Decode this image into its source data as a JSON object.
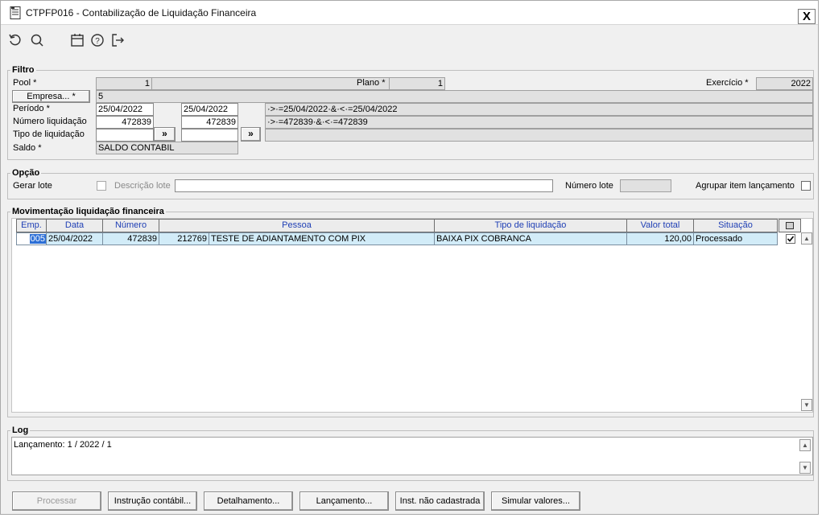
{
  "window": {
    "title": "CTPFP016 - Contabilização de Liquidação Financeira",
    "close_label": "X"
  },
  "toolbar": {
    "icons": [
      "refresh-icon",
      "search-icon",
      "calendar-icon",
      "help-icon",
      "exit-icon"
    ]
  },
  "filtro": {
    "legend": "Filtro",
    "pool_label": "Pool *",
    "pool_value": "1",
    "plano_label": "Plano *",
    "plano_value": "1",
    "exercicio_label": "Exercício *",
    "exercicio_value": "2022",
    "empresa_button": "Empresa... *",
    "empresa_value": "5",
    "periodo_label": "Período *",
    "periodo_from": "25/04/2022",
    "periodo_to": "25/04/2022",
    "periodo_expr": "·>·=25/04/2022·&·<·=25/04/2022",
    "numero_label": "Número liquidação",
    "numero_from": "472839",
    "numero_to": "472839",
    "numero_expr": "·>·=472839·&·<·=472839",
    "tipo_label": "Tipo de liquidação",
    "tipo_from": "",
    "tipo_to": "",
    "tipo_expr": "",
    "more_button": "»",
    "saldo_label": "Saldo *",
    "saldo_value": "SALDO CONTABIL"
  },
  "opcao": {
    "legend": "Opção",
    "gerar_lote_label": "Gerar lote",
    "gerar_lote_checked": false,
    "descricao_lote_label": "Descrição lote",
    "descricao_lote_value": "",
    "numero_lote_label": "Número lote",
    "numero_lote_value": "",
    "agrupar_label": "Agrupar item lançamento",
    "agrupar_checked": false
  },
  "movimentacao": {
    "legend": "Movimentação liquidação financeira",
    "columns": [
      "Emp.",
      "Data",
      "Número",
      "Pessoa",
      "Tipo de liquidação",
      "Valor total",
      "Situação"
    ],
    "rows": [
      {
        "emp": "005",
        "data": "25/04/2022",
        "numero": "472839",
        "pessoa_codigo": "212769",
        "pessoa_nome": "TESTE DE ADIANTAMENTO COM PIX",
        "tipo": "BAIXA PIX COBRANCA",
        "valor_total": "120,00",
        "situacao": "Processado",
        "checked": true
      }
    ]
  },
  "log": {
    "legend": "Log",
    "text": "Lançamento: 1 / 2022 / 1"
  },
  "buttons": {
    "processar": "Processar",
    "instrucao": "Instrução contábil...",
    "detalhamento": "Detalhamento...",
    "lancamento": "Lançamento...",
    "inst_nao_cadastrada": "Inst. não cadastrada",
    "simular": "Simular valores..."
  }
}
